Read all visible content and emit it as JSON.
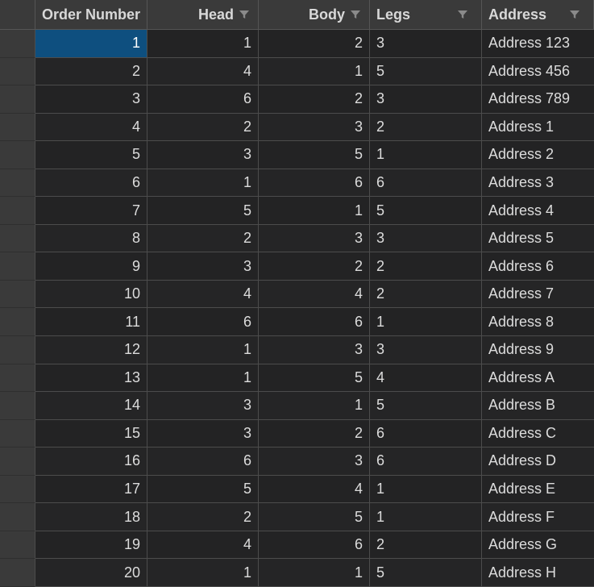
{
  "table": {
    "columns": [
      {
        "label": "Order Number",
        "filter": false
      },
      {
        "label": "Head",
        "filter": true
      },
      {
        "label": "Body",
        "filter": true
      },
      {
        "label": "Legs",
        "filter": true
      },
      {
        "label": "Address",
        "filter": true
      }
    ],
    "rows": [
      [
        "1",
        "1",
        "2",
        "3",
        "Address 123"
      ],
      [
        "2",
        "4",
        "1",
        "5",
        "Address 456"
      ],
      [
        "3",
        "6",
        "2",
        "3",
        "Address 789"
      ],
      [
        "4",
        "2",
        "3",
        "2",
        "Address 1"
      ],
      [
        "5",
        "3",
        "5",
        "1",
        "Address 2"
      ],
      [
        "6",
        "1",
        "6",
        "6",
        "Address 3"
      ],
      [
        "7",
        "5",
        "1",
        "5",
        "Address 4"
      ],
      [
        "8",
        "2",
        "3",
        "3",
        "Address 5"
      ],
      [
        "9",
        "3",
        "2",
        "2",
        "Address 6"
      ],
      [
        "10",
        "4",
        "4",
        "2",
        "Address 7"
      ],
      [
        "11",
        "6",
        "6",
        "1",
        "Address 8"
      ],
      [
        "12",
        "1",
        "3",
        "3",
        "Address 9"
      ],
      [
        "13",
        "1",
        "5",
        "4",
        "Address A"
      ],
      [
        "14",
        "3",
        "1",
        "5",
        "Address B"
      ],
      [
        "15",
        "3",
        "2",
        "6",
        "Address C"
      ],
      [
        "16",
        "6",
        "3",
        "6",
        "Address D"
      ],
      [
        "17",
        "5",
        "4",
        "1",
        "Address E"
      ],
      [
        "18",
        "2",
        "5",
        "1",
        "Address F"
      ],
      [
        "19",
        "4",
        "6",
        "2",
        "Address G"
      ],
      [
        "20",
        "1",
        "1",
        "5",
        "Address H"
      ]
    ],
    "selected_cell": {
      "row": 0,
      "col": 0
    }
  },
  "colors": {
    "background": "#1e1e1e",
    "header": "#3a3a3a",
    "selection": "#0e4f7f",
    "grid_line": "#4c4c4c",
    "text": "#dcdcdc"
  },
  "icons": {
    "column_filter": "filter-funnel-icon"
  }
}
